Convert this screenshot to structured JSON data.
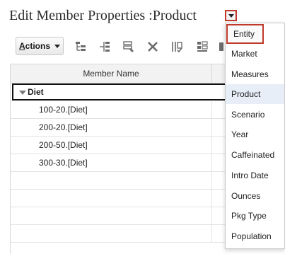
{
  "header": {
    "title": "Edit Member Properties :Product"
  },
  "toolbar": {
    "actions_label_underlined": "A",
    "actions_label_rest": "ctions",
    "icons": [
      "add-child-icon",
      "add-sibling-icon",
      "edit-properties-icon",
      "delete-icon",
      "validate-icon",
      "view-icon",
      "more-icon"
    ]
  },
  "table": {
    "columns": [
      "Member Name"
    ],
    "rows": [
      {
        "label": "Diet",
        "selected": true,
        "expanded": true
      },
      {
        "label": "100-20.[Diet]"
      },
      {
        "label": "200-20.[Diet]"
      },
      {
        "label": "200-50.[Diet]"
      },
      {
        "label": "300-30.[Diet]"
      }
    ]
  },
  "dimension_dropdown": {
    "selected": "Product",
    "focused": "Entity",
    "options": [
      "Entity",
      "Market",
      "Measures",
      "Product",
      "Scenario",
      "Year",
      "Caffeinated",
      "Intro Date",
      "Ounces",
      "Pkg Type",
      "Population"
    ]
  },
  "colors": {
    "focus_border": "#c0392b",
    "hover_bg": "#e8eef7",
    "header_bg": "#f2f2f2"
  }
}
